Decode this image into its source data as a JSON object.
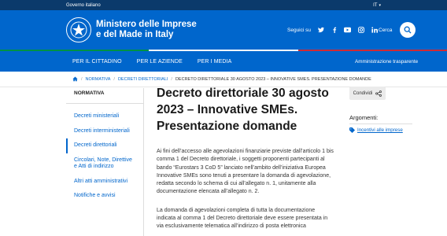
{
  "topbar": {
    "org": "Governo italiano",
    "lang": "IT"
  },
  "header": {
    "title_line1": "Ministero delle Imprese",
    "title_line2": "e del Made in Italy",
    "follow_label": "Seguici su",
    "search_label": "Cerca"
  },
  "social_icons": [
    "twitter-icon",
    "facebook-icon",
    "youtube-icon",
    "instagram-icon",
    "linkedin-icon"
  ],
  "stripe_colors": [
    "#009246",
    "#ffffff",
    "#ce2b37"
  ],
  "nav": {
    "items": [
      "PER IL CITTADINO",
      "PER LE AZIENDE",
      "PER I MEDIA"
    ],
    "right": "Amministrazione trasparente"
  },
  "breadcrumb": {
    "items": [
      "NORMATIVA",
      "DECRETI DIRETTORIALI"
    ],
    "current": "DECRETO DIRETTORIALE 30 AGOSTO 2023 – INNOVATIVE SMES. PRESENTAZIONE DOMANDE"
  },
  "sidebar": {
    "heading": "NORMATIVA",
    "items": [
      "Decreti ministeriali",
      "Decreti interministeriali",
      "Decreti direttoriali",
      "Circolari, Note, Direttive e Atti di indirizzo",
      "Altri atti amministrativi",
      "Notifiche e avvisi"
    ],
    "active_index": 2
  },
  "article": {
    "title": "Decreto direttoriale 30 agosto 2023 – Innovative SMEs. Presentazione domande",
    "p1": "Ai fini dell’accesso alle agevolazioni finanziarie previste dall’articolo 1 bis comma 1 del Decreto direttoriale, i soggetti proponenti partecipanti al bando “Eurostars 3 CoD 5” lanciato nell’ambito dell’iniziativa Europea Innovative SMEs sono tenuti a presentare la domanda di agevolazione, redatta secondo lo schema di cui all’allegato n. 1, unitamente alla documentazione elencata all’allegato n. 2.",
    "p2": "La domanda di agevolazioni completa di tutta la documentazione indicata al comma 1 del Decreto direttoriale deve essere presentata in via esclusivamente telematica all’indirizzo di posta elettronica"
  },
  "aside": {
    "share_label": "Condividi",
    "arguments_label": "Argomenti:",
    "tag": "Incentivi alle imprese"
  }
}
